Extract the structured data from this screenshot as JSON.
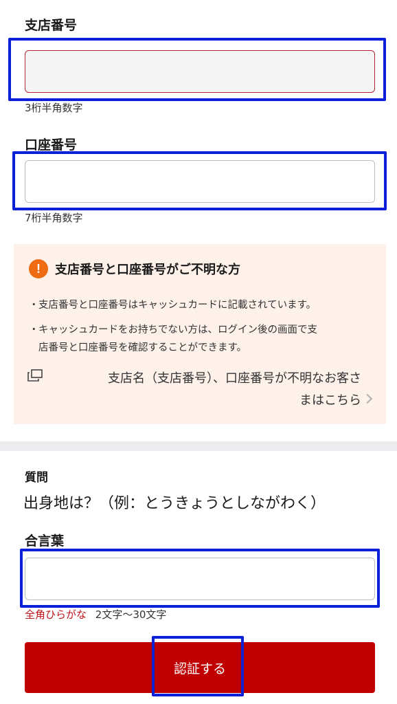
{
  "branch": {
    "label": "支店番号",
    "value": "",
    "hint": "3桁半角数字"
  },
  "account": {
    "label": "口座番号",
    "value": "",
    "hint": "7桁半角数字"
  },
  "info": {
    "icon": "exclamation-icon",
    "icon_glyph": "!",
    "title": "支店番号と口座番号がご不明な方",
    "bullet_dot": "・",
    "bullet1": "支店番号と口座番号はキャッシュカードに記載されています。",
    "bullet2_line1": "キャッシュカードをお持ちでない方は、ログイン後の画面で支",
    "bullet2_line2": "店番号と口座番号を確認することができます。",
    "link_line1": "支店名（支店番号）、口座番号が不明なお客さ",
    "link_line2": "まはこちら"
  },
  "question": {
    "label": "質問",
    "text": "出身地は？（例：とうきょうとしながわく）"
  },
  "passphrase": {
    "label": "合言葉",
    "value": "",
    "hint_red": "全角ひらがな",
    "hint": "2文字〜30文字"
  },
  "submit_label": "認証する",
  "colors": {
    "highlight": "#0a1fd8",
    "accent_red": "#c00000",
    "warning_orange": "#ef6c13",
    "info_bg": "#fdf1ea"
  }
}
